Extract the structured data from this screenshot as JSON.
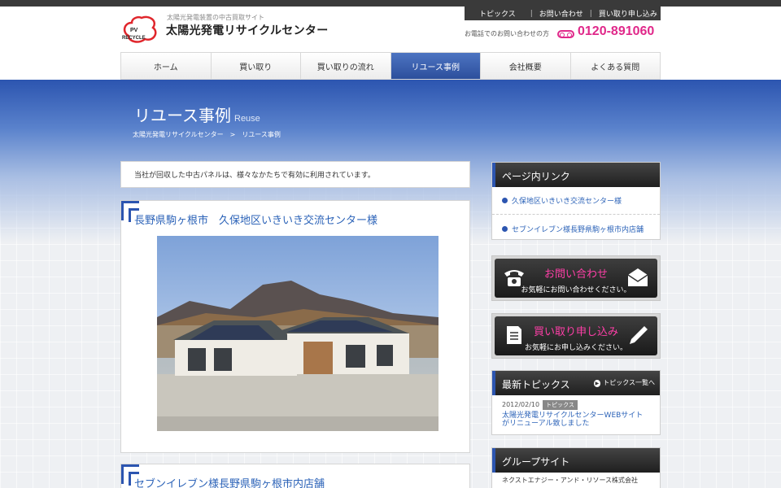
{
  "header": {
    "logo_text": "PV RECYCLE",
    "tagline": "太陽光発電装置の中古買取サイト",
    "site_name": "太陽光発電リサイクルセンター",
    "top_nav": [
      "トピックス",
      "お問い合わせ",
      "買い取り申し込み"
    ],
    "phone_label": "お電話でのお問い合わせの方",
    "phone_number": "0120-891060"
  },
  "global_nav": [
    {
      "label": "ホーム",
      "active": false
    },
    {
      "label": "買い取り",
      "active": false
    },
    {
      "label": "買い取りの流れ",
      "active": false
    },
    {
      "label": "リユース事例",
      "active": true
    },
    {
      "label": "会社概要",
      "active": false
    },
    {
      "label": "よくある質問",
      "active": false
    }
  ],
  "page": {
    "title": "リユース事例",
    "title_en": "Reuse",
    "breadcrumb": [
      "太陽光発電リサイクルセンター",
      "リユース事例"
    ],
    "breadcrumb_sep": ">",
    "intro": "当社が回収した中古パネルは、様々なかたちで有効に利用されています。"
  },
  "cases": [
    {
      "title": "長野県駒ヶ根市　久保地区いきいき交流センター様"
    },
    {
      "title": "セブンイレブン様長野県駒ヶ根市内店舗"
    }
  ],
  "sidebar": {
    "page_links_heading": "ページ内リンク",
    "page_links": [
      "久保地区いきいき交流センター様",
      "セブンイレブン様長野県駒ヶ根市内店舗"
    ],
    "contact_title": "お問い合わせ",
    "contact_sub": "お気軽にお問い合わせください。",
    "apply_title": "買い取り申し込み",
    "apply_sub": "お気軽にお申し込みください。",
    "topics_heading": "最新トピックス",
    "topics_more": "トピックス一覧へ",
    "topic_date": "2012/02/10",
    "topic_tag": "トピックス",
    "topic_text": "太陽光発電リサイクルセンターWEBサイトがリニューアル致しました",
    "group_heading": "グループサイト",
    "group_link": "ネクストエナジー・アンド・リソース株式会社"
  },
  "colors": {
    "accent": "#2c55b0",
    "brand_pink": "#e0288a",
    "link": "#2c63b8"
  }
}
